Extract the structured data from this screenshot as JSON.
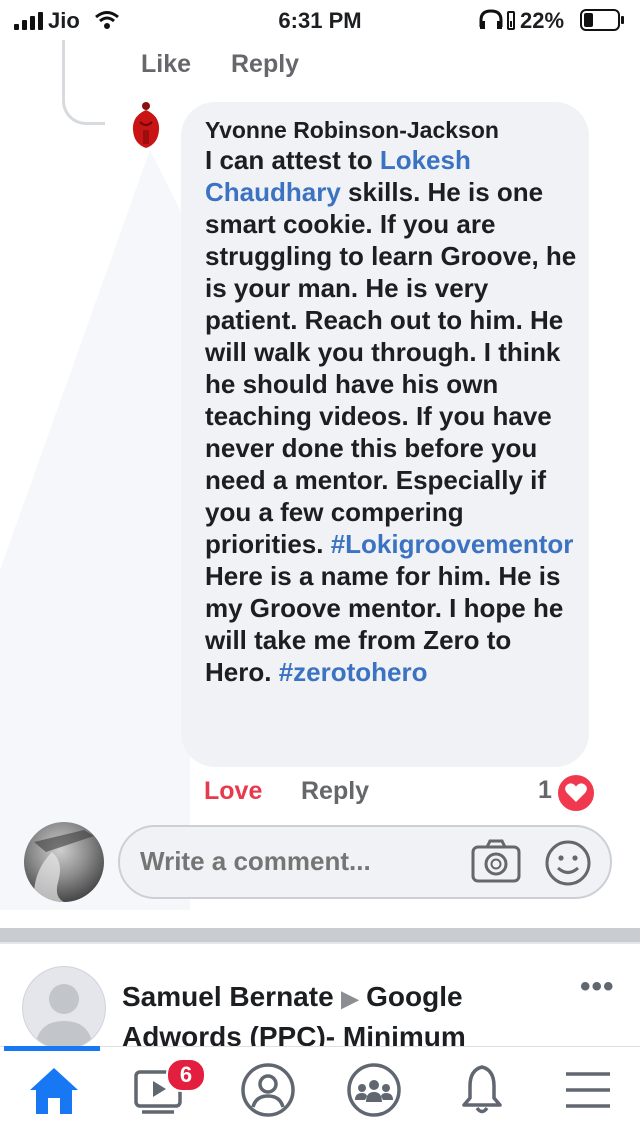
{
  "status_bar": {
    "carrier": "Jio",
    "time": "6:31 PM",
    "battery": "22%"
  },
  "prev_comment_actions": {
    "like": "Like",
    "reply": "Reply"
  },
  "comment": {
    "author": "Yvonne Robinson-Jackson",
    "segments": [
      "I can attest to ",
      "Lokesh Chaudhary",
      " skills.  He is one smart cookie.  If you are struggling to learn Groove, he is your man. He is very patient. Reach out to him. He will walk you through. I think he should have his own teaching videos.  If you have never done this before you need a mentor. Especially if you a few compering priorities. ",
      "#Lokigroovementor",
      " Here is a name for him. He is my Groove mentor. I hope he will take me from Zero to Hero. ",
      "#zerotohero"
    ],
    "reaction_label": "Love",
    "reply_label": "Reply",
    "reaction_count": "1"
  },
  "composer": {
    "placeholder": "Write a comment..."
  },
  "next_post": {
    "author": "Samuel Bernate",
    "arrow": "▶",
    "group": "Google Adwords (PPC)- Minimum",
    "more": "•••"
  },
  "nav": {
    "active": "home",
    "items": [
      "home-icon",
      "watch-icon",
      "profile-icon",
      "groups-icon",
      "notifications-icon",
      "menu-icon"
    ],
    "watch_badge": "6"
  },
  "colors": {
    "link": "#3b73c2",
    "love": "#e83a4d",
    "accent": "#1877f2",
    "bubble": "#f0f2f5"
  }
}
